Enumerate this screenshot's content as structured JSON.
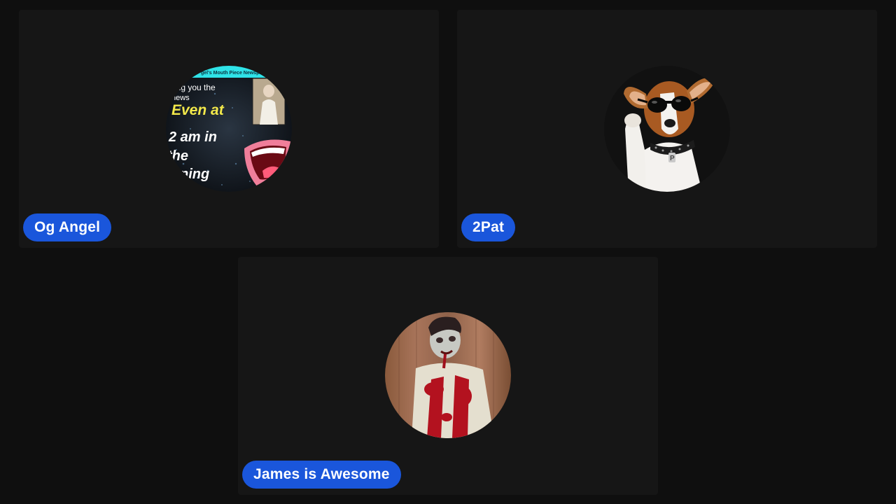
{
  "participants": [
    {
      "name": "Og Angel",
      "avatar": {
        "icon": "newspaper-collage-avatar-icon",
        "banner_text": "gel's Mouth Piece Newspa",
        "line1": "ring you the",
        "line2": "news",
        "line3": "Even at",
        "line4": "2 am in",
        "line5": "the",
        "line6": "orning"
      }
    },
    {
      "name": "2Pat",
      "avatar": {
        "icon": "dog-with-sunglasses-avatar-icon",
        "collar_tag": "P"
      }
    },
    {
      "name": "James is Awesome",
      "avatar": {
        "icon": "zombie-avatar-icon"
      }
    }
  ],
  "colors": {
    "background": "#0f0f0f",
    "tile": "#161616",
    "badge": "#1a56db",
    "badge_text": "#ffffff"
  }
}
